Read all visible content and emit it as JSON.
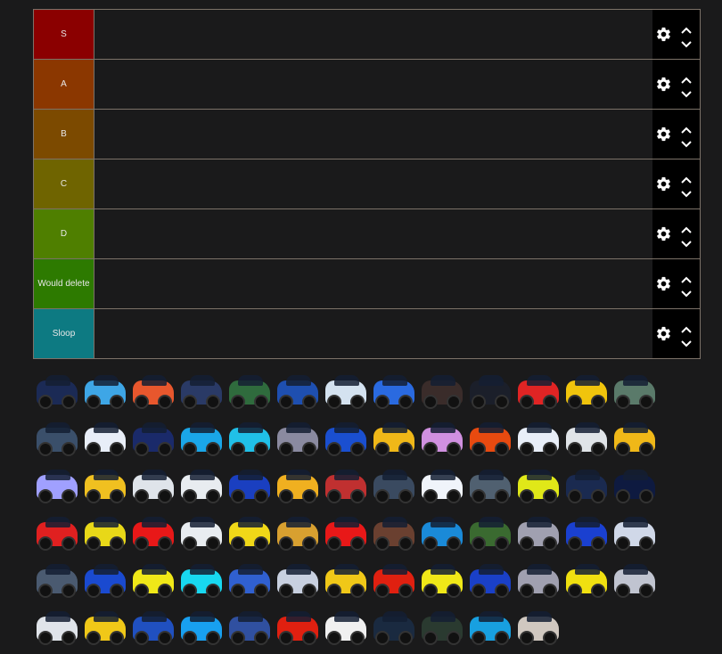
{
  "tiers": [
    {
      "label": "S",
      "color": "#8b0000"
    },
    {
      "label": "A",
      "color": "#8b3700"
    },
    {
      "label": "B",
      "color": "#7c4a00"
    },
    {
      "label": "C",
      "color": "#6f6400"
    },
    {
      "label": "D",
      "color": "#4f7f00"
    },
    {
      "label": "Would delete",
      "color": "#2d7a00"
    },
    {
      "label": "Sloop",
      "color": "#0d7a82"
    }
  ],
  "icons": {
    "settings": "gear-icon",
    "move_up": "chevron-up-icon",
    "move_down": "chevron-down-icon"
  },
  "pool_items": [
    "#1b2a55",
    "#3ea6e6",
    "#e8572d",
    "#2a3a66",
    "#2f6b3d",
    "#1e4fb0",
    "#d4e2f0",
    "#2a6ae0",
    "#3a2c2a",
    "#1b1f2a",
    "#e02424",
    "#f0c40c",
    "#5a7a6a",
    "#3a4f6a",
    "#e8eef8",
    "#1a2a6a",
    "#1aa6e8",
    "#20c0e8",
    "#8a8aa0",
    "#1a4fd0",
    "#f0b818",
    "#d090e0",
    "#e84a10",
    "#e8eef8",
    "#e0e4e8",
    "#f0b818",
    "#a0a0ff",
    "#f0c020",
    "#dfe4ea",
    "#e8ecf0",
    "#1a3fc0",
    "#f0b020",
    "#c03030",
    "#3a4a60",
    "#f0f4fa",
    "#506070",
    "#e0e818",
    "#1a2a50",
    "#0e1a40",
    "#e02020",
    "#e8d818",
    "#e81818",
    "#e8ecf0",
    "#f0d818",
    "#d8a030",
    "#e81818",
    "#6a4030",
    "#1a8ad8",
    "#3a6a30",
    "#a0a0b0",
    "#1a40d0",
    "#d0d8e8",
    "#4a5a70",
    "#1a4ad0",
    "#f0e818",
    "#18d8f0",
    "#3060d0",
    "#c8d0e0",
    "#f0c818",
    "#e02010",
    "#f0e818",
    "#1a40c8",
    "#a0a0b0",
    "#f0e010",
    "#c0c4d0",
    "#e0e4ea",
    "#f0c818",
    "#2050c0",
    "#18a0f0",
    "#3050a0",
    "#e02010",
    "#f0f0f0",
    "#1a2a40",
    "#2a3a30",
    "#18a0e0",
    "#d0c8c0"
  ]
}
